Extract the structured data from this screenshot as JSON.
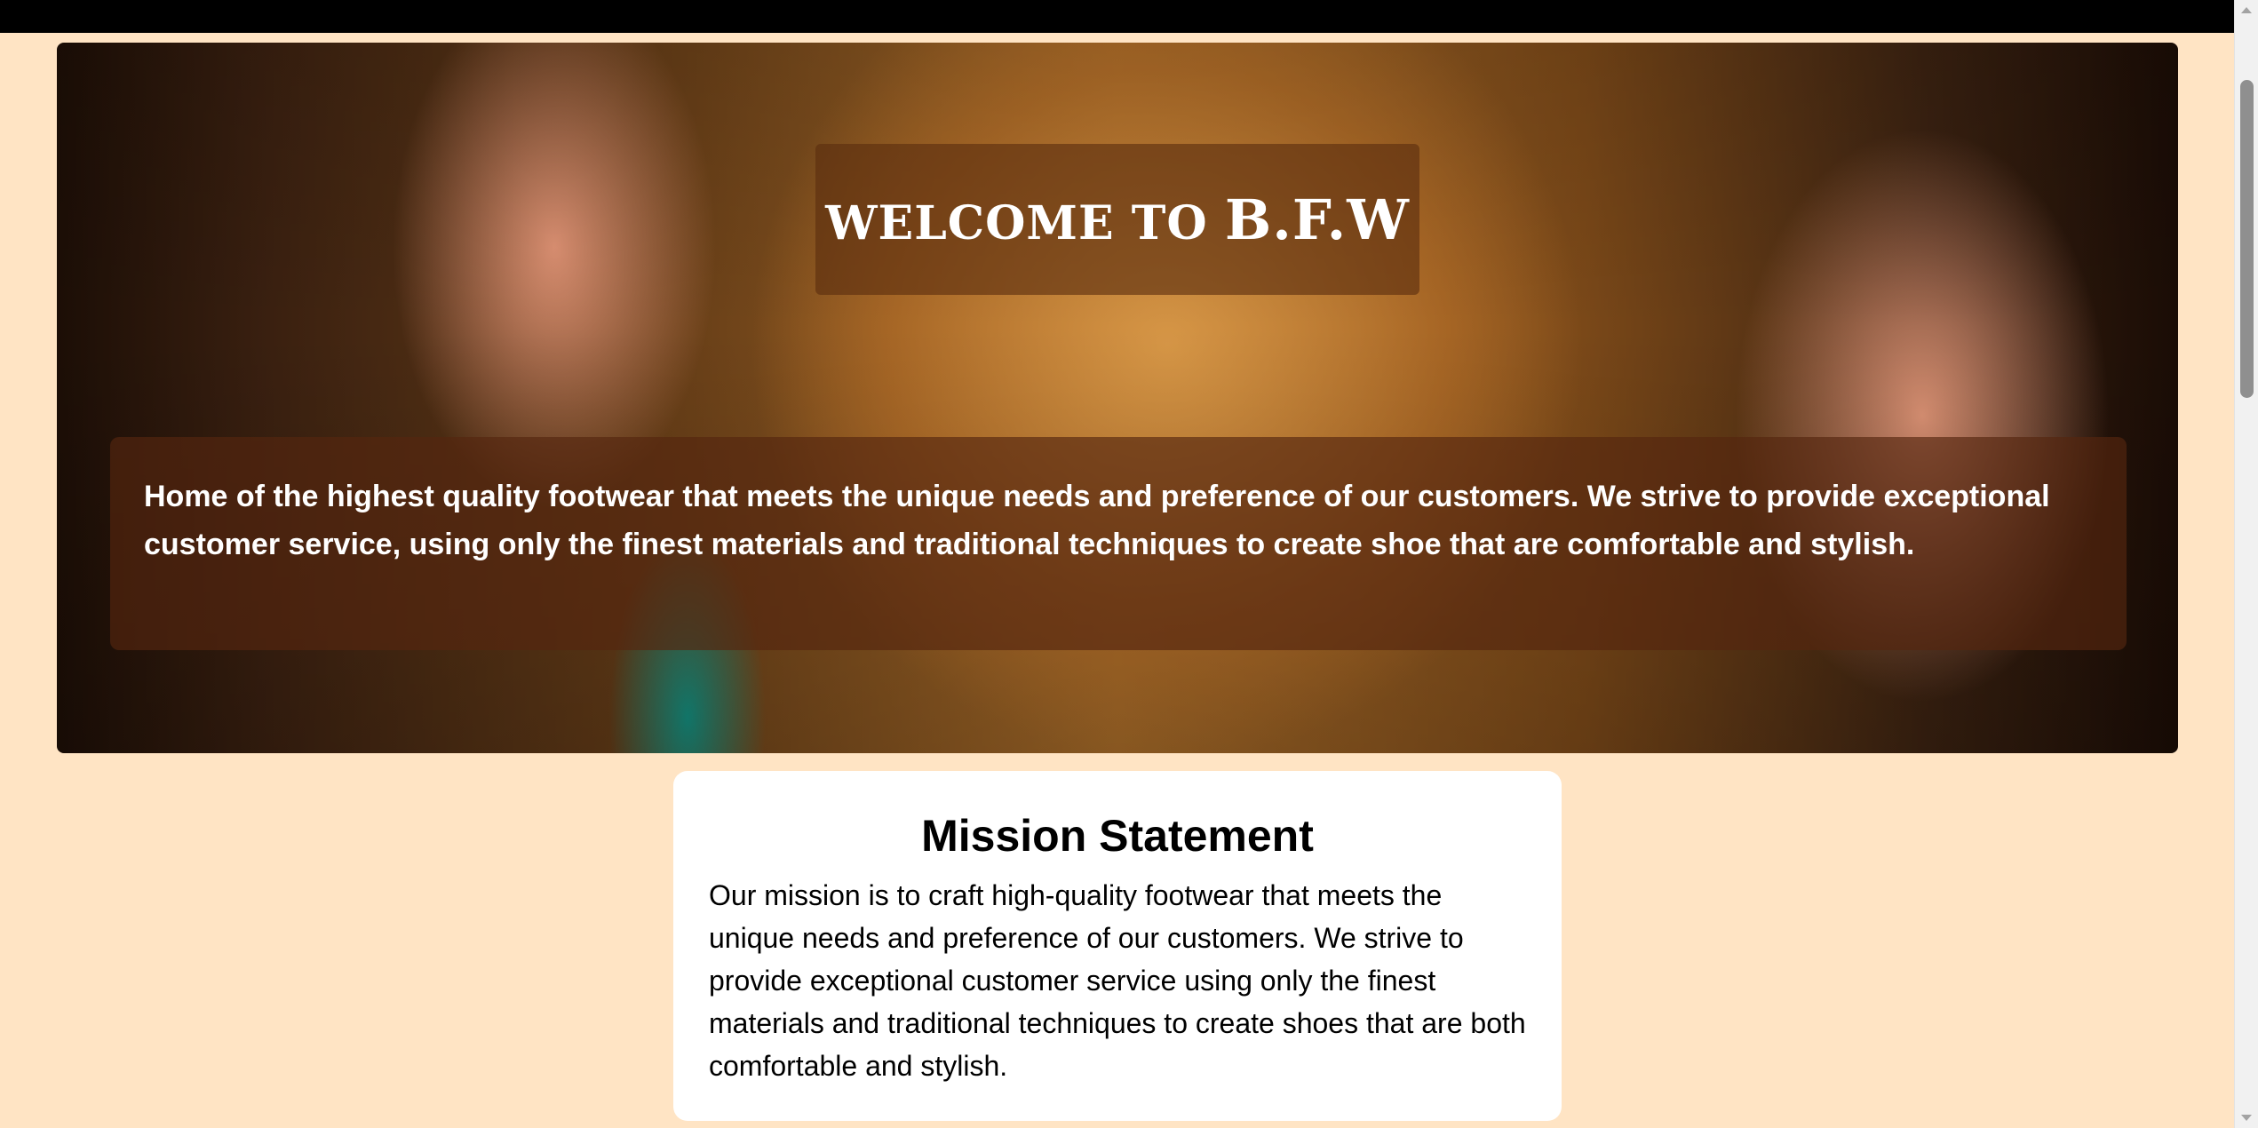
{
  "hero": {
    "title_prefix": "WELCOME TO ",
    "title_brand": "B.F.W",
    "description": "Home of the highest quality footwear that meets the unique needs and preference of our customers. We strive to provide exceptional customer service, using only the finest materials and traditional techniques to create shoe that are comfortable and stylish."
  },
  "mission": {
    "title": "Mission Statement",
    "text": "Our mission is to craft high-quality footwear that meets the unique needs and preference of our customers. We strive to provide exceptional customer service using only the finest materials and traditional techniques to create shoes that are both comfortable and stylish."
  },
  "colors": {
    "page_background": "#ffe4c4",
    "top_bar": "#000000",
    "card_background": "#ffffff"
  }
}
